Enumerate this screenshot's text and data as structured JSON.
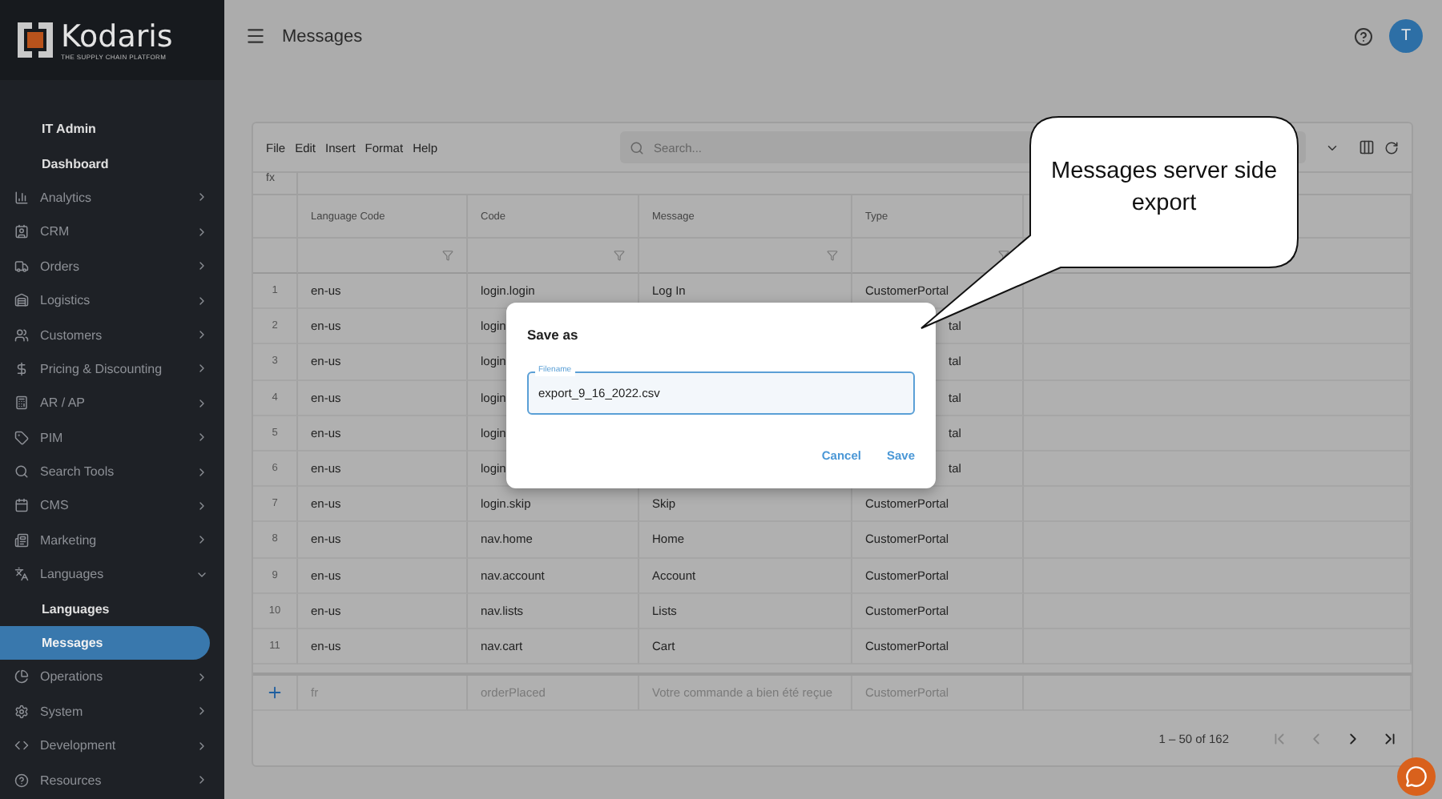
{
  "header": {
    "title": "Messages",
    "avatar": "T"
  },
  "sidebar": {
    "logo": {
      "name": "Kodaris",
      "tagline": "THE SUPPLY CHAIN PLATFORM"
    },
    "items": [
      {
        "kind": "sub",
        "label": "IT Admin",
        "selected": false
      },
      {
        "kind": "sub",
        "label": "Dashboard",
        "selected": false
      },
      {
        "kind": "section",
        "label": "Analytics",
        "expanded": false
      },
      {
        "kind": "section",
        "label": "CRM",
        "expanded": false
      },
      {
        "kind": "section",
        "label": "Orders",
        "expanded": false
      },
      {
        "kind": "section",
        "label": "Logistics",
        "expanded": false
      },
      {
        "kind": "section",
        "label": "Customers",
        "expanded": false
      },
      {
        "kind": "section",
        "label": "Pricing & Discounting",
        "expanded": false
      },
      {
        "kind": "section",
        "label": "AR / AP",
        "expanded": false
      },
      {
        "kind": "section",
        "label": "PIM",
        "expanded": false
      },
      {
        "kind": "section",
        "label": "Search Tools",
        "expanded": false
      },
      {
        "kind": "section",
        "label": "CMS",
        "expanded": false
      },
      {
        "kind": "section",
        "label": "Marketing",
        "expanded": false
      },
      {
        "kind": "section",
        "label": "Languages",
        "expanded": true,
        "children": [
          {
            "kind": "sub",
            "label": "Languages",
            "selected": false
          },
          {
            "kind": "sub",
            "label": "Messages",
            "selected": true
          }
        ]
      },
      {
        "kind": "section",
        "label": "Operations",
        "expanded": false
      },
      {
        "kind": "section",
        "label": "System",
        "expanded": false
      },
      {
        "kind": "section",
        "label": "Development",
        "expanded": false
      },
      {
        "kind": "section",
        "label": "Resources",
        "expanded": false
      }
    ]
  },
  "sheet": {
    "menu": [
      "File",
      "Edit",
      "Insert",
      "Format",
      "Help"
    ],
    "search": {
      "placeholder": "Search..."
    },
    "formula_label": "fx",
    "columns": [
      "Language Code",
      "Code",
      "Message",
      "Type"
    ],
    "rows": [
      {
        "num": "1",
        "language_code": "en-us",
        "code": "login.login",
        "message": "Log In",
        "type": "CustomerPortal",
        "covered": false
      },
      {
        "num": "2",
        "language_code": "en-us",
        "code": "login",
        "type": "tal",
        "covered": true
      },
      {
        "num": "3",
        "language_code": "en-us",
        "code": "login",
        "type": "tal",
        "covered": true
      },
      {
        "num": "4",
        "language_code": "en-us",
        "code": "login",
        "type": "tal",
        "covered": true
      },
      {
        "num": "5",
        "language_code": "en-us",
        "code": "login",
        "type": "tal",
        "covered": true
      },
      {
        "num": "6",
        "language_code": "en-us",
        "code": "login",
        "type": "tal",
        "covered": true
      },
      {
        "num": "7",
        "language_code": "en-us",
        "code": "login.skip",
        "message": "Skip",
        "type": "CustomerPortal",
        "covered": false
      },
      {
        "num": "8",
        "language_code": "en-us",
        "code": "nav.home",
        "message": "Home",
        "type": "CustomerPortal",
        "covered": false
      },
      {
        "num": "9",
        "language_code": "en-us",
        "code": "nav.account",
        "message": "Account",
        "type": "CustomerPortal",
        "covered": false
      },
      {
        "num": "10",
        "language_code": "en-us",
        "code": "nav.lists",
        "message": "Lists",
        "type": "CustomerPortal",
        "covered": false
      },
      {
        "num": "11",
        "language_code": "en-us",
        "code": "nav.cart",
        "message": "Cart",
        "type": "CustomerPortal",
        "covered": false
      }
    ],
    "new_row": {
      "language_code": "fr",
      "code": "orderPlaced",
      "message": "Votre commande a bien été reçue",
      "type": "CustomerPortal"
    },
    "pagination": "1 – 50 of 162"
  },
  "dialog": {
    "title": "Save as",
    "field": {
      "label": "Filename",
      "value": "export_9_16_2022.csv"
    },
    "buttons": [
      "Cancel",
      "Save"
    ]
  },
  "callout": {
    "text": "Messages server side export"
  }
}
